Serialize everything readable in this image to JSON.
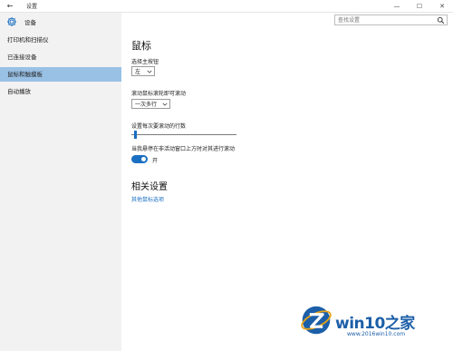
{
  "window": {
    "title": "设置",
    "back_glyph": "←",
    "minimize_glyph": "—",
    "maximize_glyph": "☐",
    "close_glyph": "✕"
  },
  "sidebar": {
    "app_title": "设备",
    "items": [
      {
        "label": "打印机和扫描仪",
        "selected": false
      },
      {
        "label": "已连接设备",
        "selected": false
      },
      {
        "label": "鼠标和触摸板",
        "selected": true
      },
      {
        "label": "自动播放",
        "selected": false
      }
    ]
  },
  "search": {
    "placeholder": "查找设置",
    "value": ""
  },
  "main": {
    "title": "鼠标",
    "primary_button": {
      "label": "选择主按钮",
      "value": "左"
    },
    "wheel_scroll": {
      "label": "滚动鼠标滚轮即可滚动",
      "value": "一次多行"
    },
    "lines_scroll": {
      "label": "设置每次要滚动的行数",
      "slider_fraction": 0.03
    },
    "inactive_scroll": {
      "label": "当我悬停在非活动窗口上方时对其进行滚动",
      "state": "开"
    },
    "related": {
      "title": "相关设置",
      "link": "其他鼠标选项"
    }
  },
  "watermark": {
    "brand": "win10之家",
    "url": "www.2016win10.com"
  },
  "colors": {
    "accent": "#1a6fc2",
    "sidebar_bg": "#f2f2f2",
    "selected_bg": "#99c1e5"
  }
}
